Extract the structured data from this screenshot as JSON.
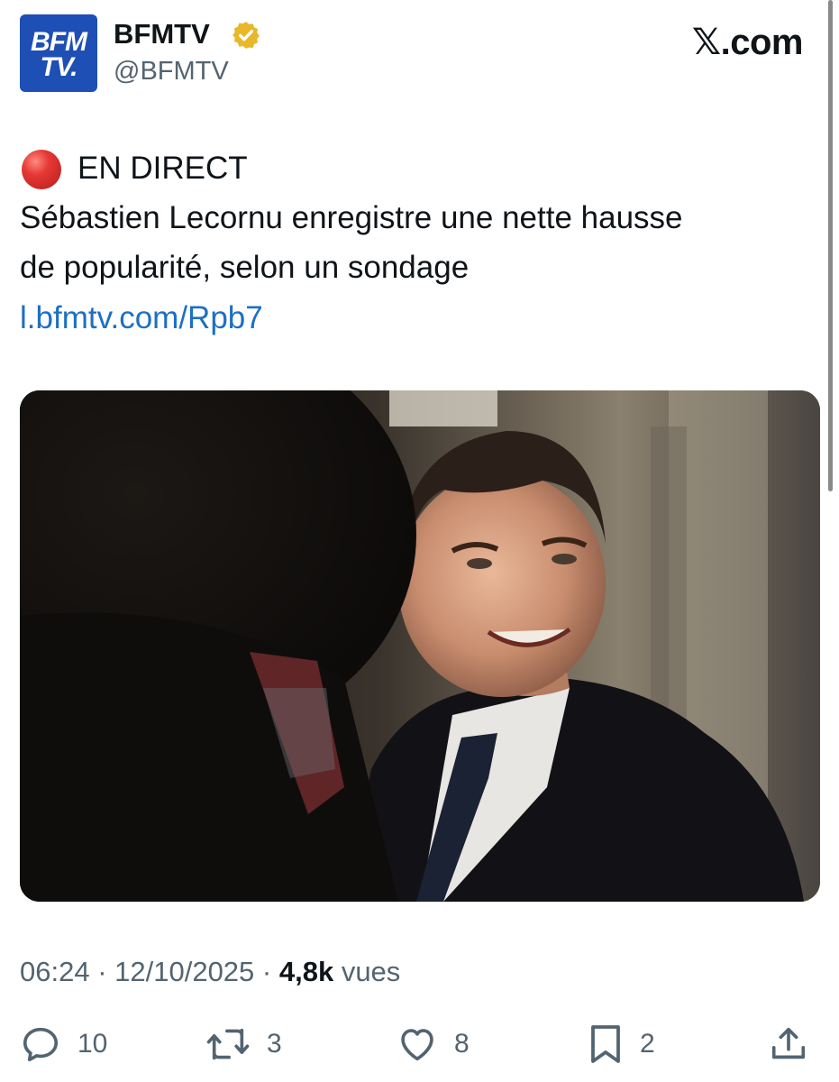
{
  "author": {
    "avatar_text_line1": "BFM",
    "avatar_text_line2": "TV.",
    "display_name": "BFMTV",
    "handle": "@BFMTV",
    "verified_icon": "verified-badge-gold"
  },
  "site": {
    "label_x": "𝕏",
    "label_rest": ".com"
  },
  "tweet": {
    "live_icon": "red-circle",
    "live_label": "EN DIRECT",
    "line1": "Sébastien Lecornu enregistre une nette hausse",
    "line2": "de popularité, selon un sondage",
    "link": "l.bfmtv.com/Rpb7"
  },
  "media": {
    "description_icon": "photo"
  },
  "meta": {
    "time": "06:24",
    "sep1": " · ",
    "date": "12/10/2025",
    "sep2": " · ",
    "views_count": "4,8k",
    "views_label": " vues"
  },
  "actions": {
    "replies": "10",
    "retweets": "3",
    "likes": "8",
    "bookmarks": "2"
  },
  "colors": {
    "brand_blue": "#1d4fb4",
    "link_blue": "#1d6fc4",
    "verified_gold": "#e8b829",
    "muted_gray": "#536471",
    "text": "#0f1419"
  }
}
